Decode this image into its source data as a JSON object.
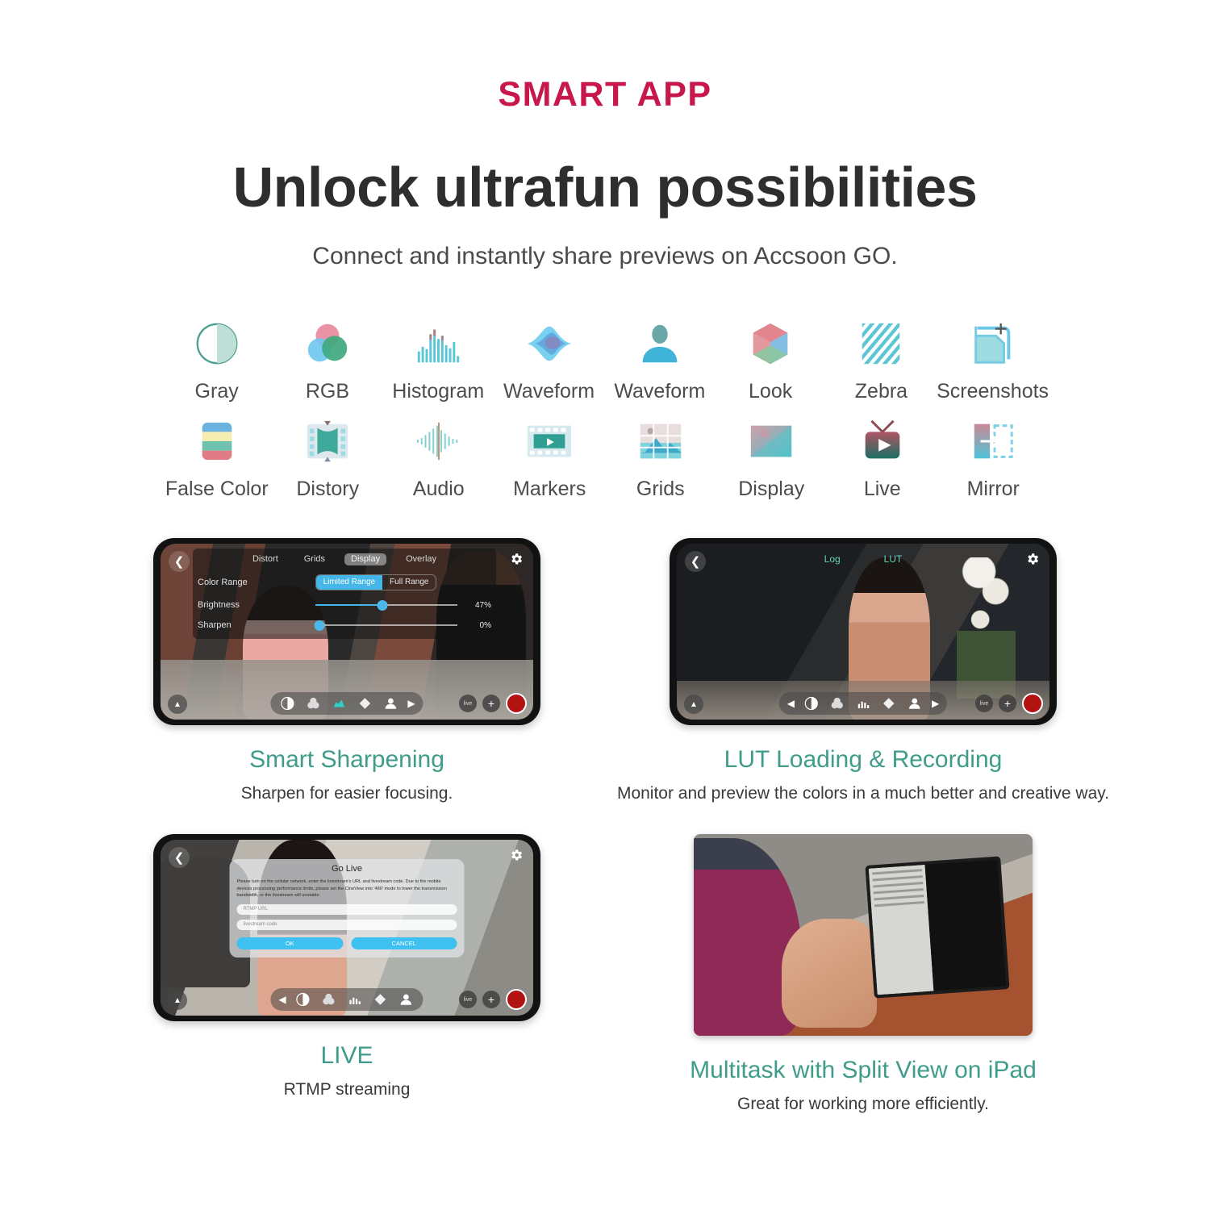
{
  "header": {
    "eyebrow": "SMART APP",
    "headline": "Unlock ultrafun possibilities",
    "subhead": "Connect and instantly share previews on Accsoon GO.",
    "eyebrow_color": "#c8174b",
    "accent_color": "#3f9c8a"
  },
  "icon_grid": {
    "row1": [
      {
        "label": "Gray",
        "icon": "gray-circle-icon"
      },
      {
        "label": "RGB",
        "icon": "rgb-circles-icon"
      },
      {
        "label": "Histogram",
        "icon": "histogram-icon"
      },
      {
        "label": "Waveform",
        "icon": "waveform-diamond-icon"
      },
      {
        "label": "Waveform",
        "icon": "waveform-person-icon"
      },
      {
        "label": "Look",
        "icon": "look-cube-icon"
      },
      {
        "label": "Zebra",
        "icon": "zebra-stripes-icon"
      },
      {
        "label": "Screenshots",
        "icon": "screenshots-icon"
      }
    ],
    "row2": [
      {
        "label": "False Color",
        "icon": "false-color-icon"
      },
      {
        "label": "Distory",
        "icon": "distort-icon"
      },
      {
        "label": "Audio",
        "icon": "audio-wave-icon"
      },
      {
        "label": "Markers",
        "icon": "markers-film-icon"
      },
      {
        "label": "Grids",
        "icon": "grids-icon"
      },
      {
        "label": "Display",
        "icon": "display-icon"
      },
      {
        "label": "Live",
        "icon": "live-tv-icon"
      },
      {
        "label": "Mirror",
        "icon": "mirror-icon"
      }
    ]
  },
  "features": [
    {
      "title": "Smart Sharpening",
      "subtitle": "Sharpen for easier focusing.",
      "phone_ui": {
        "tabs": [
          "Distort",
          "Grids",
          "Display",
          "Overlay"
        ],
        "active_tab": "Display",
        "color_range_label": "Color Range",
        "range_options": [
          "Limited Range",
          "Full Range"
        ],
        "range_active": "Limited Range",
        "brightness_label": "Brightness",
        "brightness_value": "47%",
        "sharpen_label": "Sharpen",
        "sharpen_value": "0%",
        "live_badge": "live"
      }
    },
    {
      "title": "LUT Loading & Recording",
      "subtitle": "Monitor and preview the colors in a much better and creative way.",
      "phone_ui": {
        "log_label": "Log",
        "lut_label": "LUT",
        "live_badge": "live"
      }
    },
    {
      "title": "LIVE",
      "subtitle": "RTMP streaming",
      "phone_ui": {
        "dialog_title": "Go Live",
        "dialog_body": "Please turn on the cellular network, enter the livestream's URL and livestream code. Due to the mobile devices processing performance limits, please set the CineView into '480' mode to lower the transmission bandwidth, or the livestream will unstable.",
        "input_url_placeholder": "RTMP URL",
        "input_code_placeholder": "livestream code",
        "ok_label": "OK",
        "cancel_label": "CANCEL",
        "live_badge": "live"
      }
    },
    {
      "title": "Multitask with Split View on iPad",
      "subtitle": "Great for working more efficiently."
    }
  ]
}
